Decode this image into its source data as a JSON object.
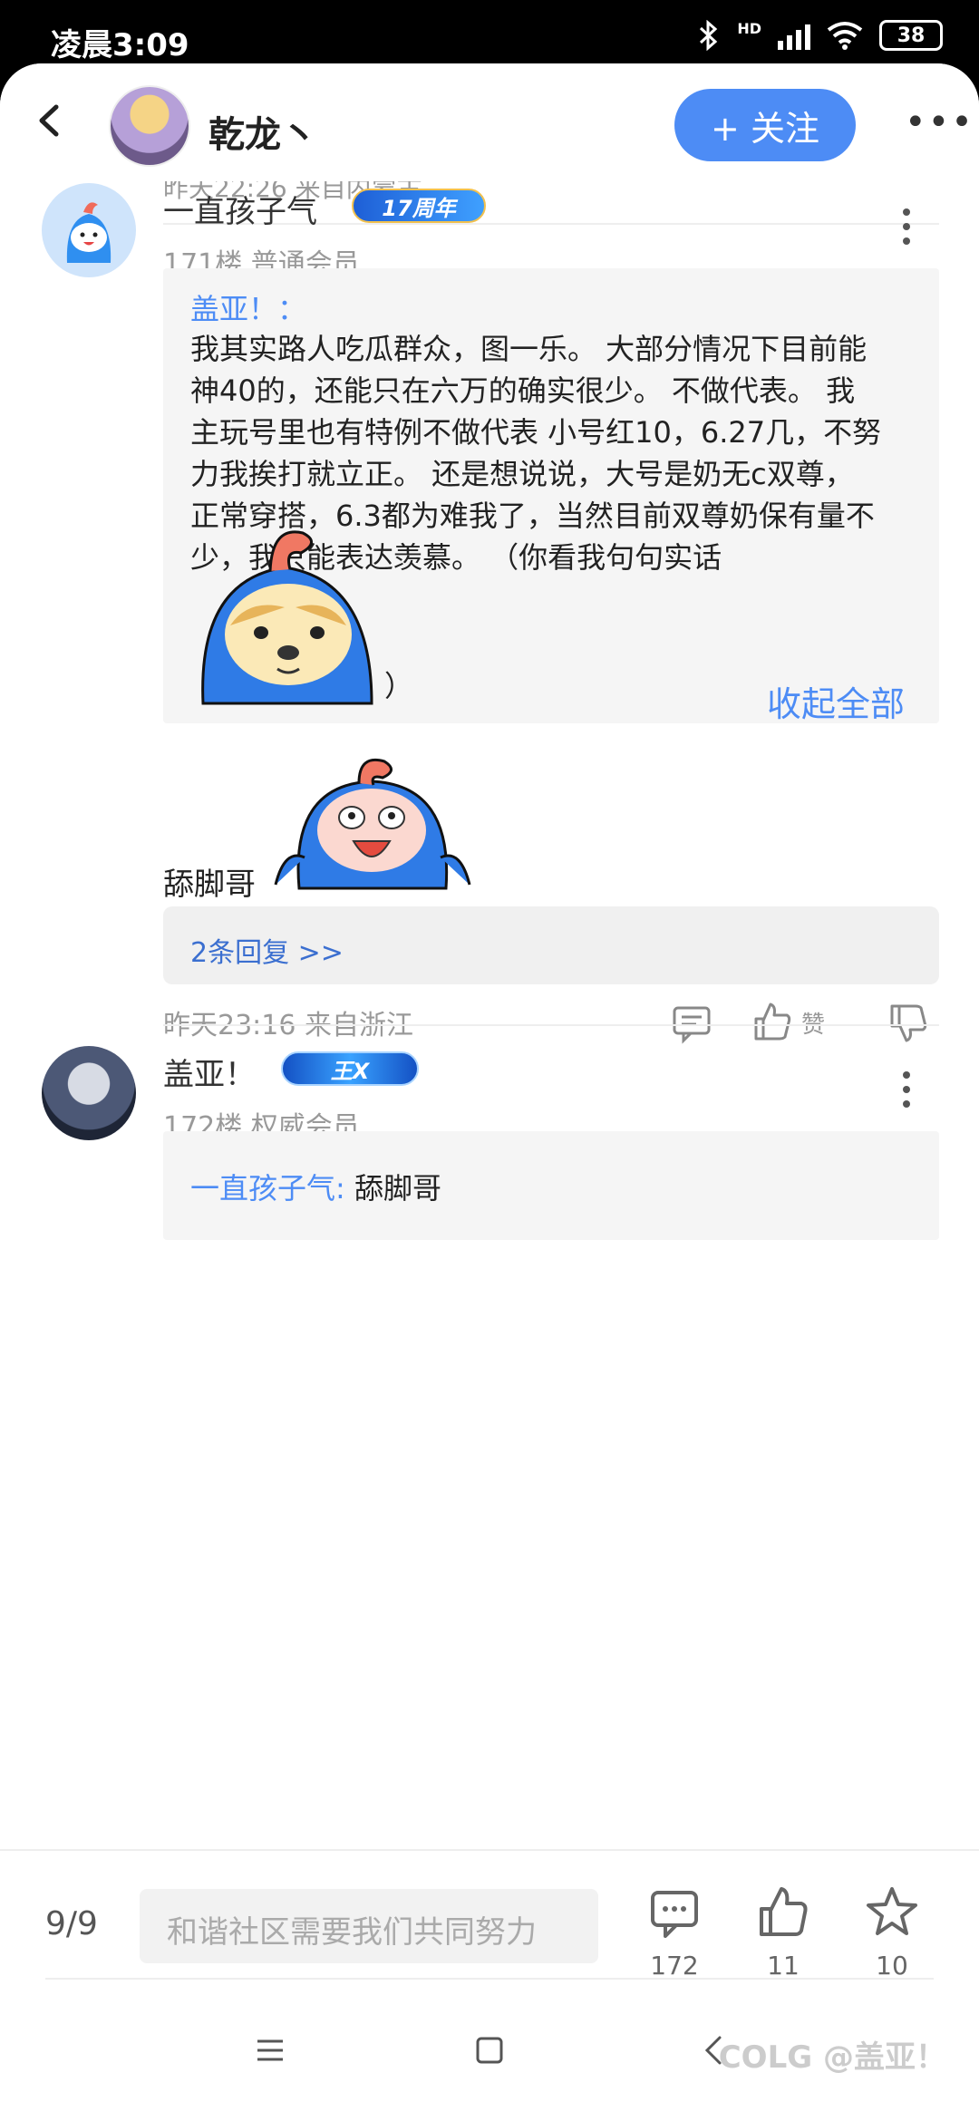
{
  "status_bar": {
    "time": "凌晨3:09",
    "bluetooth": "bluetooth-icon",
    "network": "HD",
    "battery": "38"
  },
  "header": {
    "author_name": "乾龙丶",
    "follow_label": "+ 关注"
  },
  "clipped_meta": "昨天22:26 来自内蒙古",
  "comments": [
    {
      "user": "一直孩子气",
      "badge": "17周年",
      "badge_color": "#2c7be5",
      "floor": "171楼 普通会员",
      "quote_name": "盖亚！：",
      "quote_lines": [
        "我其实路人吃瓜群众，图一乐。 大部分情况下目前能",
        "神40的，还能只在六万的确实很少。 不做代表。 我",
        "主玩号里也有特例不做代表 小号红10，6.27几，不努",
        "力我挨打就立正。 还是想说说，大号是奶无c双尊，",
        "正常穿搭，6.3都为难我了，当然目前双尊奶保有量不",
        "少，我只能表达羡慕。 （你看我句句实话"
      ],
      "quote_tail": "）",
      "collapse_label": "收起全部",
      "reply_text": "舔脚哥",
      "replies_label": "2条回复 >>",
      "time_loc": "昨天23:16 来自浙江",
      "like_label": "赞"
    },
    {
      "user": "盖亚！",
      "badge": "王X",
      "badge_color": "#1e6fd9",
      "floor": "172楼 权威会员",
      "quote_name": "一直孩子气:",
      "quote_text": "舔脚哥"
    }
  ],
  "bottom_bar": {
    "page_count": "9/9",
    "input_placeholder": "和谐社区需要我们共同努力",
    "comment_count": "172",
    "like_count": "11",
    "star_count": "10"
  },
  "watermark": "COLG @盖亚！",
  "accent_color": "#4d8cf5"
}
